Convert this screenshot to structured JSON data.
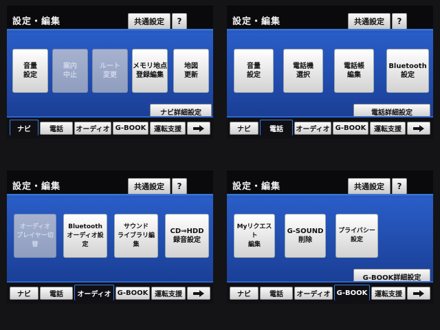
{
  "panels": [
    {
      "title": "設定・編集",
      "common_label": "共通設定",
      "help_label": "?",
      "tiles": [
        {
          "label": "音量\n設定",
          "enabled": true
        },
        {
          "label": "案内\n中止",
          "enabled": false
        },
        {
          "label": "ルート\n変更",
          "enabled": false
        },
        {
          "label": "メモリ地点\n登録編集",
          "enabled": true
        },
        {
          "label": "地図\n更新",
          "enabled": true
        }
      ],
      "detail_label": "ナビ詳細設定",
      "tabs": [
        "ナビ",
        "電話",
        "オーディオ",
        "G-BOOK",
        "運転支援"
      ],
      "active_tab": 0
    },
    {
      "title": "設定・編集",
      "common_label": "共通設定",
      "help_label": "?",
      "tiles": [
        {
          "label": "音量\n設定",
          "enabled": true
        },
        {
          "label": "電話機\n選択",
          "enabled": true
        },
        {
          "label": "電話帳\n編集",
          "enabled": true
        },
        {
          "label": "Bluetooth\n設定",
          "enabled": true
        }
      ],
      "detail_label": "電話詳細設定",
      "tabs": [
        "ナビ",
        "電話",
        "オーディオ",
        "G-BOOK",
        "運転支援"
      ],
      "active_tab": 1
    },
    {
      "title": "設定・編集",
      "common_label": "共通設定",
      "help_label": "?",
      "tiles": [
        {
          "label": "オーディオ\nプレイヤー切替",
          "enabled": false
        },
        {
          "label": "Bluetooth\nオーディオ設定",
          "enabled": true
        },
        {
          "label": "サウンド\nライブラリ編集",
          "enabled": true
        },
        {
          "label": "CD⇒HDD\n録音設定",
          "enabled": true
        }
      ],
      "detail_label": "",
      "tabs": [
        "ナビ",
        "電話",
        "オーディオ",
        "G-BOOK",
        "運転支援"
      ],
      "active_tab": 2
    },
    {
      "title": "設定・編集",
      "common_label": "共通設定",
      "help_label": "?",
      "tiles": [
        {
          "label": "Myリクエスト\n編集",
          "enabled": true
        },
        {
          "label": "G-SOUND\n削除",
          "enabled": true
        },
        {
          "label": "プライバシー\n設定",
          "enabled": true
        }
      ],
      "detail_label": "G-BOOK詳細設定",
      "tabs": [
        "ナビ",
        "電話",
        "オーディオ",
        "G-BOOK",
        "運転支援"
      ],
      "active_tab": 3
    }
  ],
  "icons": {
    "next": "right-arrow-icon"
  },
  "colors": {
    "accent": "#2a5dc8",
    "tab_border": "#3b7ce4"
  }
}
